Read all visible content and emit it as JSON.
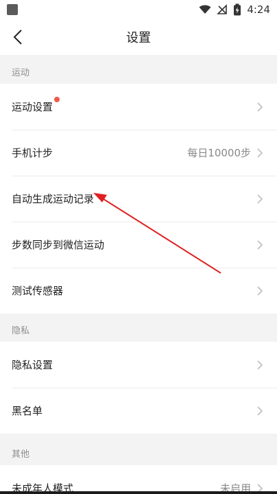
{
  "status_bar": {
    "time": "4:24",
    "icons": [
      "wifi-icon",
      "no-signal-icon",
      "battery-charging-icon"
    ]
  },
  "header": {
    "title": "设置",
    "back_icon": "chevron-left-icon"
  },
  "sections": {
    "sport": {
      "header": "运动",
      "items": [
        {
          "label": "运动设置",
          "value": "",
          "badge": true
        },
        {
          "label": "手机计步",
          "value": "每日10000步"
        },
        {
          "label": "自动生成运动记录",
          "value": ""
        },
        {
          "label": "步数同步到微信运动",
          "value": ""
        },
        {
          "label": "测试传感器",
          "value": ""
        }
      ]
    },
    "privacy": {
      "header": "隐私",
      "items": [
        {
          "label": "隐私设置",
          "value": ""
        },
        {
          "label": "黑名单",
          "value": ""
        }
      ]
    },
    "other": {
      "header": "其他",
      "items": [
        {
          "label": "未成年人模式",
          "value": "未启用"
        }
      ]
    }
  },
  "colors": {
    "badge": "#f05a4a",
    "annotation_arrow": "#e02020",
    "background": "#f3f3f3"
  }
}
